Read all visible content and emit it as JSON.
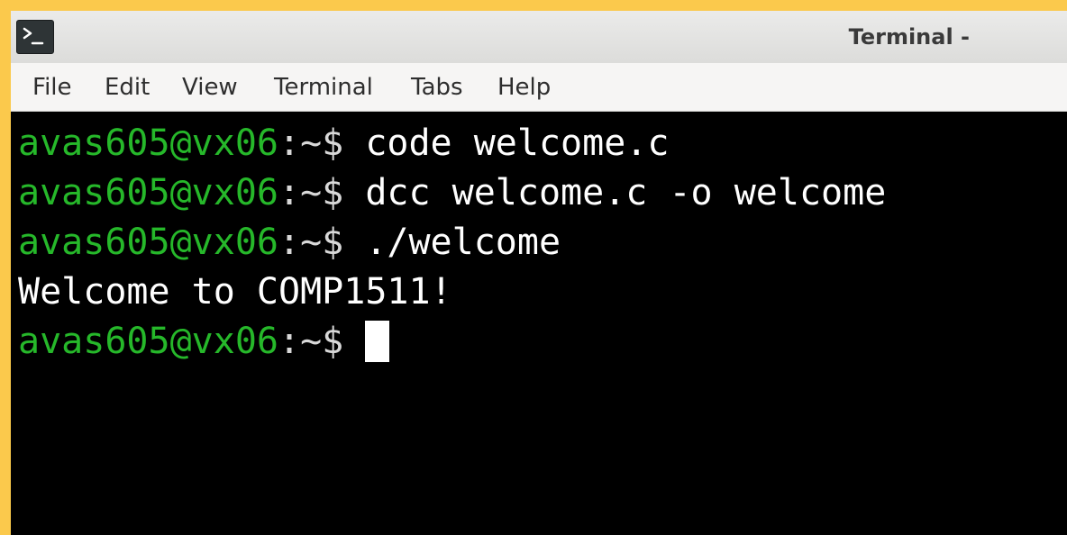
{
  "window": {
    "title": "Terminal -"
  },
  "menu": {
    "items": [
      "File",
      "Edit",
      "View",
      "Terminal",
      "Tabs",
      "Help"
    ]
  },
  "terminal": {
    "prompt_user": "avas605@vx06",
    "prompt_path": ":~$ ",
    "lines": [
      {
        "type": "prompt",
        "command": "code welcome.c"
      },
      {
        "type": "prompt",
        "command": "dcc welcome.c -o welcome"
      },
      {
        "type": "prompt",
        "command": "./welcome"
      },
      {
        "type": "output",
        "text": "Welcome to COMP1511!"
      },
      {
        "type": "prompt",
        "command": ""
      }
    ]
  },
  "colors": {
    "background_frame": "#fbc94c",
    "terminal_bg": "#000000",
    "prompt_user": "#26b82a",
    "text": "#ffffff"
  },
  "icons": {
    "app_icon": "terminal-icon"
  }
}
